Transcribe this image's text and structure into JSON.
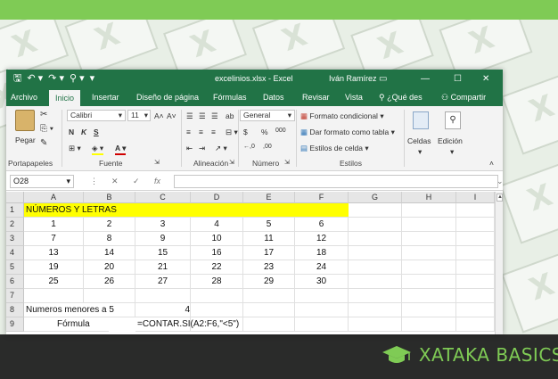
{
  "window": {
    "title": "excelinios.xlsx - Excel",
    "user": "Iván Ramírez",
    "controls": [
      "▭",
      "—",
      "☐",
      "✕"
    ]
  },
  "quick_access": [
    "🖫",
    "↶ ▾",
    "↷ ▾",
    "⚲ ▾",
    "▾"
  ],
  "tabs": [
    "Archivo",
    "Inicio",
    "Insertar",
    "Diseño de página",
    "Fórmulas",
    "Datos",
    "Revisar",
    "Vista"
  ],
  "tell_me": "¿Qué des",
  "share": "Compartir",
  "ribbon": {
    "clipboard": {
      "paste": "Pegar",
      "label": "Portapapeles"
    },
    "font": {
      "name": "Calibri",
      "size": "11",
      "bold": "N",
      "italic": "K",
      "underline": "S",
      "grow": "A˄",
      "shrink": "A˅",
      "label": "Fuente"
    },
    "alignment": {
      "label": "Alineación"
    },
    "number": {
      "format": "General",
      "currency": "$",
      "percent": "%",
      "thousands": "000",
      "inc_dec": "←,0",
      "dec_dec": ",00",
      "label": "Número"
    },
    "styles": {
      "conditional": "Formato condicional",
      "table": "Dar formato como tabla",
      "cell": "Estilos de celda",
      "label": "Estilos"
    },
    "cells": {
      "label": "Celdas"
    },
    "editing": {
      "label": "Edición"
    }
  },
  "formula_bar": {
    "name_box": "O28",
    "cancel": "✕",
    "enter": "✓",
    "fx": "fx",
    "value": ""
  },
  "columns": [
    "A",
    "B",
    "C",
    "D",
    "E",
    "F",
    "G",
    "H",
    "I"
  ],
  "rows": [
    "1",
    "2",
    "3",
    "4",
    "5",
    "6",
    "7",
    "8",
    "9"
  ],
  "sheet": {
    "r1": "NÚMEROS Y LETRAS",
    "table": [
      [
        "1",
        "2",
        "3",
        "4",
        "5",
        "6"
      ],
      [
        "7",
        "8",
        "9",
        "10",
        "11",
        "12"
      ],
      [
        "13",
        "14",
        "15",
        "16",
        "17",
        "18"
      ],
      [
        "19",
        "20",
        "21",
        "22",
        "23",
        "24"
      ],
      [
        "25",
        "26",
        "27",
        "28",
        "29",
        "30"
      ]
    ],
    "r8_label": "Numeros menores a 5",
    "r8_value": "4",
    "r9_label": "Fórmula",
    "r9_formula": "=CONTAR.SI(A2:F6,\"<5\")"
  },
  "brand": "XATAKA BASICS",
  "colors": {
    "excel_green": "#217346",
    "highlight": "#ffff00",
    "brand_green": "#7fcb55"
  }
}
